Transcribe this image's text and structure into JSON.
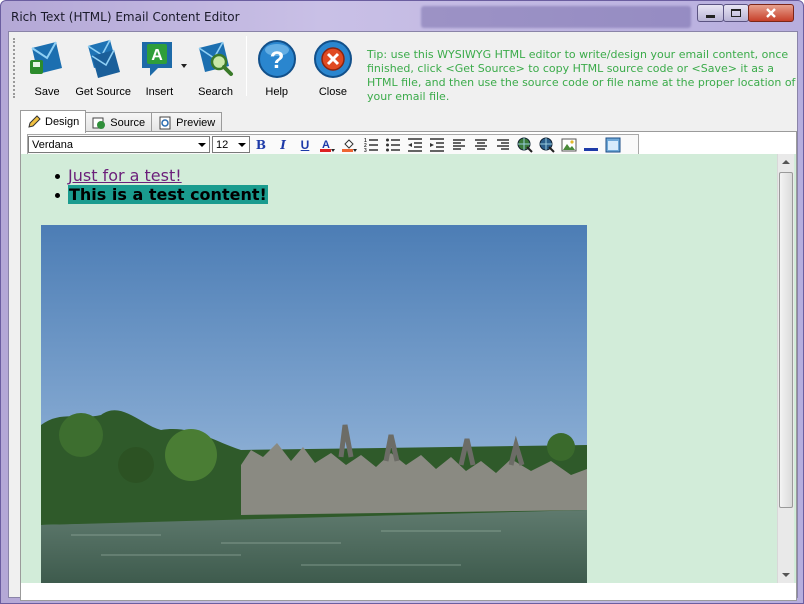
{
  "window": {
    "title": "Rich Text (HTML) Email Content Editor"
  },
  "toolbar": {
    "buttons": [
      {
        "label": "Save",
        "icon": "save-icon"
      },
      {
        "label": "Get Source",
        "icon": "envelopes-icon"
      },
      {
        "label": "Insert",
        "icon": "insert-icon"
      },
      {
        "label": "Search",
        "icon": "search-icon"
      },
      {
        "label": "Help",
        "icon": "help-icon"
      },
      {
        "label": "Close",
        "icon": "close-icon"
      }
    ],
    "tip": "Tip: use this WYSIWYG HTML editor to write/design your email content, once finished, click <Get Source> to copy HTML source code or <Save> it as a HTML file, and then use the source code or file name at the proper location of your email file."
  },
  "tabs": [
    {
      "label": "Design",
      "active": true
    },
    {
      "label": "Source",
      "active": false
    },
    {
      "label": "Preview",
      "active": false
    }
  ],
  "format": {
    "font_value": "Verdana",
    "size_value": "12",
    "bold": "B",
    "italic": "I",
    "underline": "U"
  },
  "content": {
    "items": [
      "Just for a test!",
      "This is a test content!"
    ]
  },
  "colors": {
    "editor_bg": "#d2ecd9",
    "highlight": "#1a9c8f",
    "link": "#6b1f7a",
    "tip": "#3bab4a"
  }
}
